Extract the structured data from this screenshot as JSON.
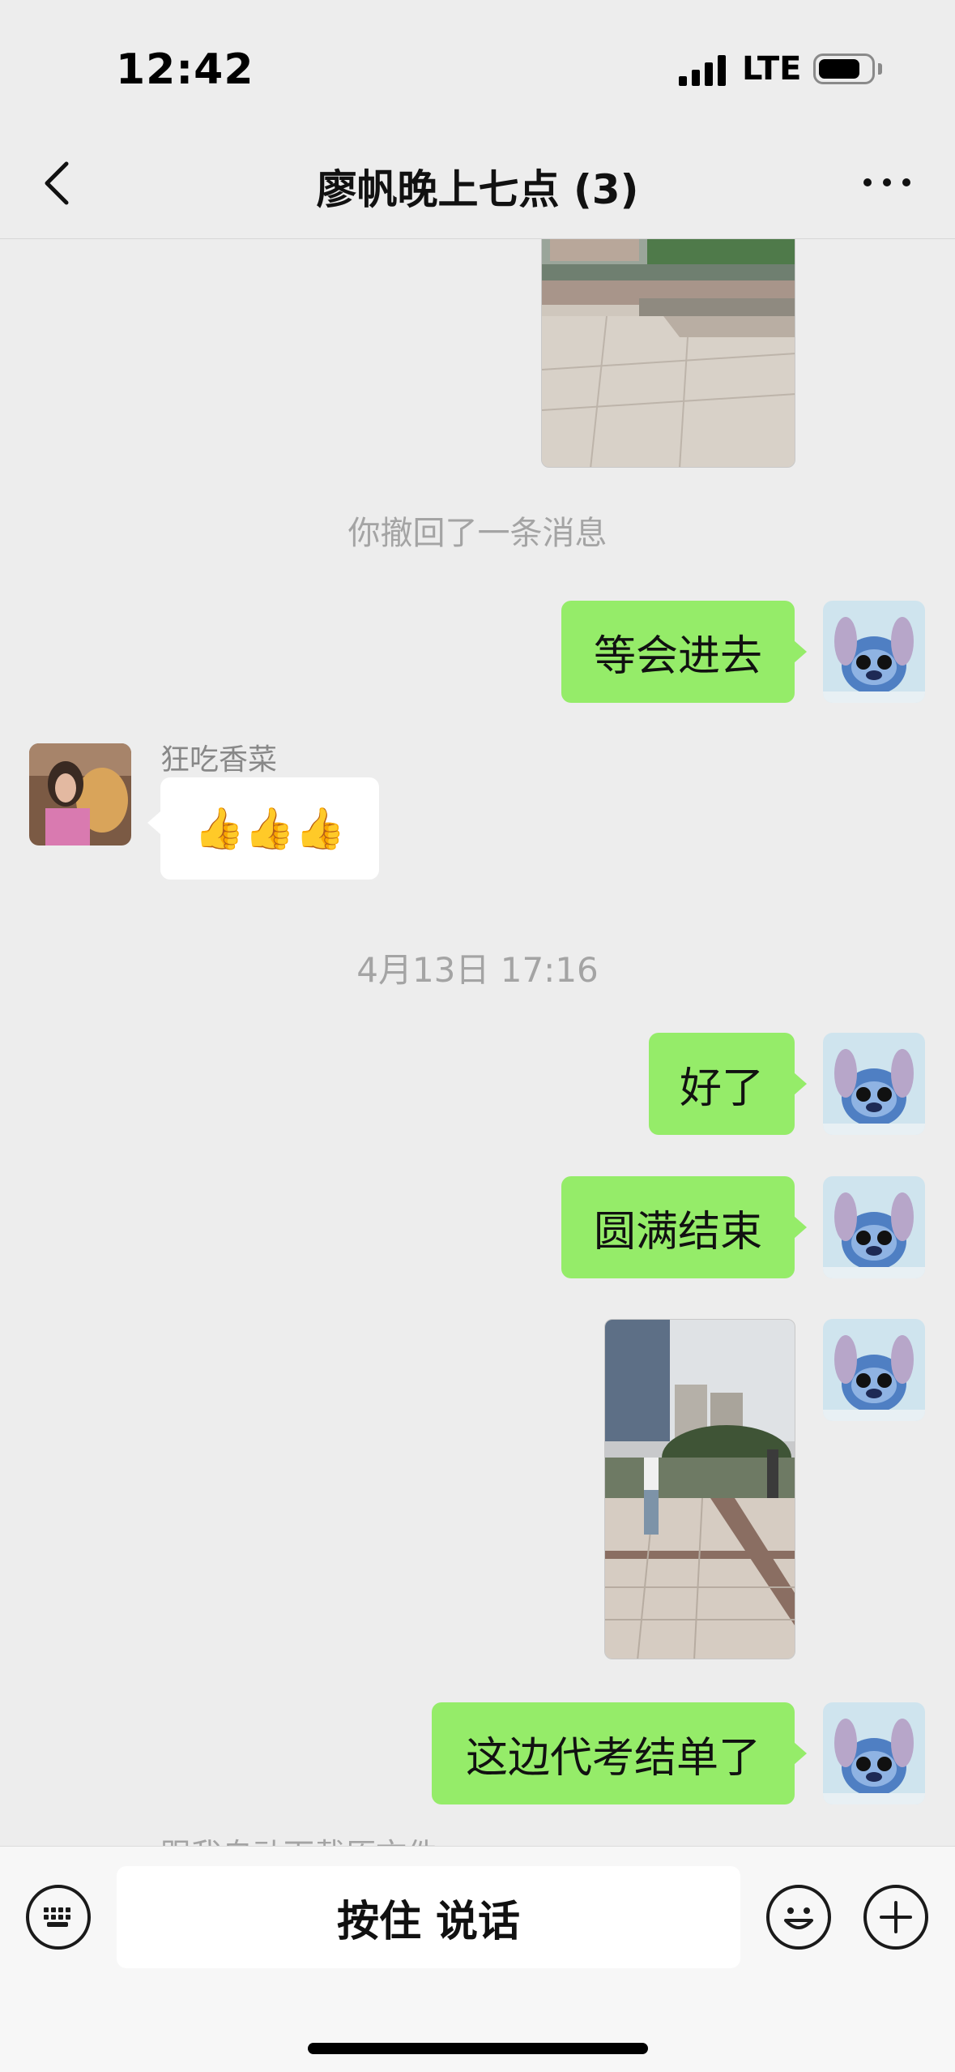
{
  "status_bar": {
    "time": "12:42",
    "network": "LTE"
  },
  "nav": {
    "title": "廖帆晚上七点 (3)"
  },
  "chat": {
    "recall_notice": "你撤回了一条消息",
    "msg_wait": "等会进去",
    "other_sender": "狂吃香菜",
    "thumbs": "👍👍👍",
    "timestamp": "4月13日 17:16",
    "msg_ok": "好了",
    "msg_done": "圆满结束",
    "msg_closed": "这边代考结单了",
    "partial_hint": "跟我自动下载原文件"
  },
  "bottom": {
    "talk_label": "按住 说话"
  },
  "colors": {
    "bubble_sent": "#95ec69",
    "bubble_received": "#ffffff",
    "background": "#ededed"
  },
  "icons": [
    "back-arrow-icon",
    "more-dots-icon",
    "keyboard-icon",
    "emoji-icon",
    "plus-icon"
  ]
}
